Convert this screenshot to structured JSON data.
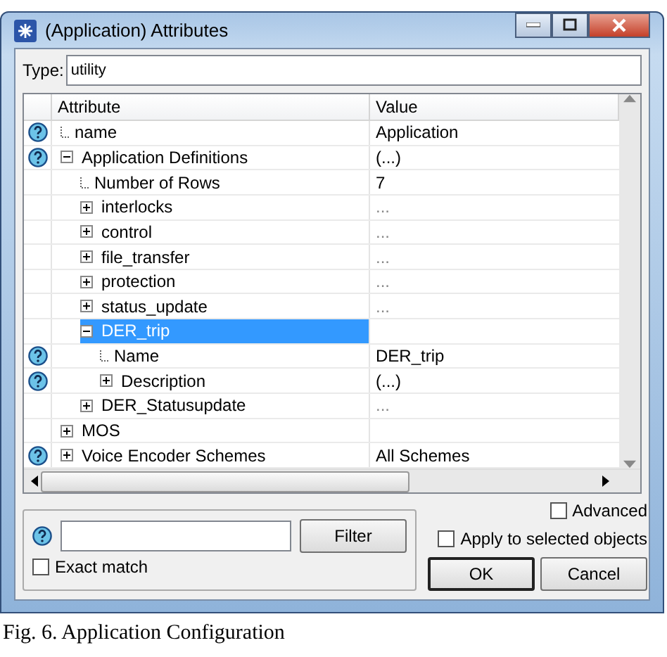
{
  "window": {
    "title": "(Application) Attributes"
  },
  "type_field": {
    "label": "Type:",
    "value": "utility"
  },
  "table": {
    "columns": [
      "Attribute",
      "Value"
    ],
    "rows": [
      {
        "name": "name",
        "value": "Application",
        "help": true
      },
      {
        "name": "Application Definitions",
        "value": "(...)",
        "help": true,
        "expanded": true,
        "children": [
          {
            "name": "Number of Rows",
            "value": "7",
            "help": false
          },
          {
            "name": "interlocks",
            "value": "...",
            "help": false,
            "expanded": false,
            "dimmed": true
          },
          {
            "name": "control",
            "value": "...",
            "help": false,
            "expanded": false,
            "dimmed": true
          },
          {
            "name": "file_transfer",
            "value": "...",
            "help": false,
            "expanded": false,
            "dimmed": true
          },
          {
            "name": "protection",
            "value": "...",
            "help": false,
            "expanded": false,
            "dimmed": true
          },
          {
            "name": "status_update",
            "value": "...",
            "help": false,
            "expanded": false,
            "dimmed": true
          },
          {
            "name": "DER_trip",
            "help": false,
            "expanded": true,
            "selected": true,
            "children": [
              {
                "name": "Name",
                "value": "DER_trip",
                "help": true
              },
              {
                "name": "Description",
                "value": "(...)",
                "help": true,
                "expanded": false
              }
            ]
          },
          {
            "name": "DER_Statusupdate",
            "value": "...",
            "help": false,
            "expanded": false,
            "dimmed": true
          }
        ]
      },
      {
        "name": "MOS",
        "help": false,
        "expanded": false
      },
      {
        "name": "Voice Encoder Schemes",
        "value": "All Schemes",
        "help": true,
        "expanded": false
      }
    ]
  },
  "filter": {
    "button": {
      "label": "Filter"
    },
    "exact_match": {
      "label": "Exact match",
      "checked": false
    }
  },
  "advanced": {
    "label": "Advanced",
    "checked": false
  },
  "apply_selected": {
    "label": "Apply to selected objects",
    "checked": false
  },
  "buttons": [
    {
      "label": "OK",
      "default": true
    },
    {
      "label": "Cancel",
      "default": false
    }
  ],
  "caption": "Fig. 6. Application Configuration"
}
